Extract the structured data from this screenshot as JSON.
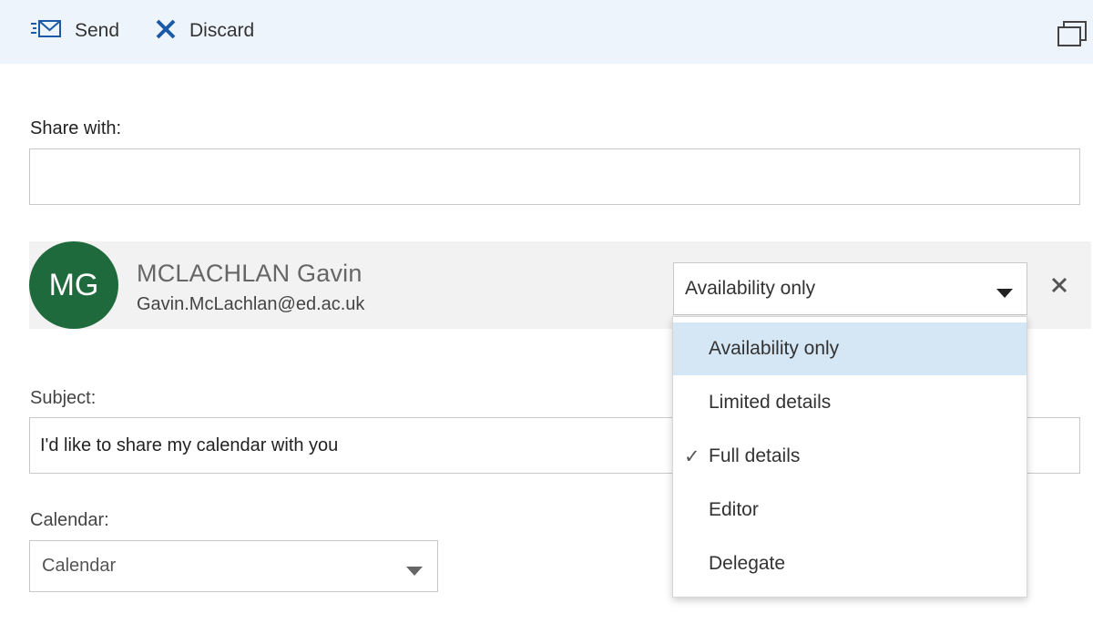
{
  "toolbar": {
    "send_label": "Send",
    "discard_label": "Discard"
  },
  "share": {
    "label": "Share with:",
    "value": "",
    "placeholder": ""
  },
  "recipient": {
    "initials": "MG",
    "name": "MCLACHLAN Gavin",
    "email": "Gavin.McLachlan@ed.ac.uk",
    "permission": "Availability only",
    "avatar_color": "#1f6a3c"
  },
  "subject": {
    "label": "Subject:",
    "value": "I'd like to share my calendar with you"
  },
  "calendar": {
    "label": "Calendar:",
    "value": "Calendar"
  },
  "permission_menu": {
    "options": [
      {
        "label": "Availability only",
        "highlighted": true,
        "checked": false
      },
      {
        "label": "Limited details",
        "highlighted": false,
        "checked": false
      },
      {
        "label": "Full details",
        "highlighted": false,
        "checked": true
      },
      {
        "label": "Editor",
        "highlighted": false,
        "checked": false
      },
      {
        "label": "Delegate",
        "highlighted": false,
        "checked": false
      }
    ],
    "check_glyph": "✓",
    "highlight_color": "#d5e6f5"
  },
  "colors": {
    "accent": "#1a5aa6",
    "toolbar_bg": "#eef4fb"
  }
}
